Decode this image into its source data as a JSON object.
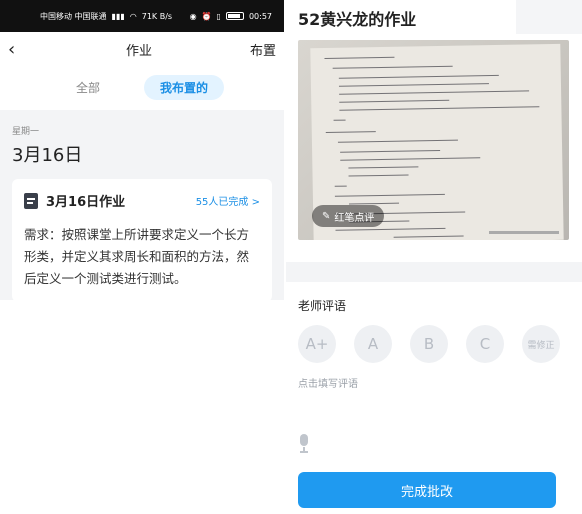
{
  "left_screen": {
    "status_bar": {
      "carrier": "中国移动 中国联通",
      "speed": "71K B/s",
      "time": "00:57"
    },
    "nav": {
      "back_icon": "chevron-left-icon",
      "title": "作业",
      "right_label": "布置"
    },
    "tabs": [
      {
        "label": "全部",
        "active": false
      },
      {
        "label": "我布置的",
        "active": true
      }
    ],
    "day": {
      "weekday": "星期一",
      "date": "3月16日"
    },
    "card": {
      "title": "3月16日作业",
      "completed": "55人已完成",
      "chevron": ">",
      "requirement": "需求：按照课堂上所讲要求定义一个长方形类，并定义其求周长和面积的方法，然后定义一个测试类进行测试。"
    }
  },
  "right_screen": {
    "title": "52黄兴龙的作业",
    "photo_button": "红笔点评",
    "comment_label": "老师评语",
    "grades": [
      "A+",
      "A",
      "B",
      "C",
      "需修正"
    ],
    "comment_hint": "点击填写评语",
    "finish_button": "完成批改"
  },
  "colors": {
    "accent": "#1f9af0",
    "tab_active_bg": "#e3f3ff",
    "section_bg": "#f3f4f6"
  }
}
